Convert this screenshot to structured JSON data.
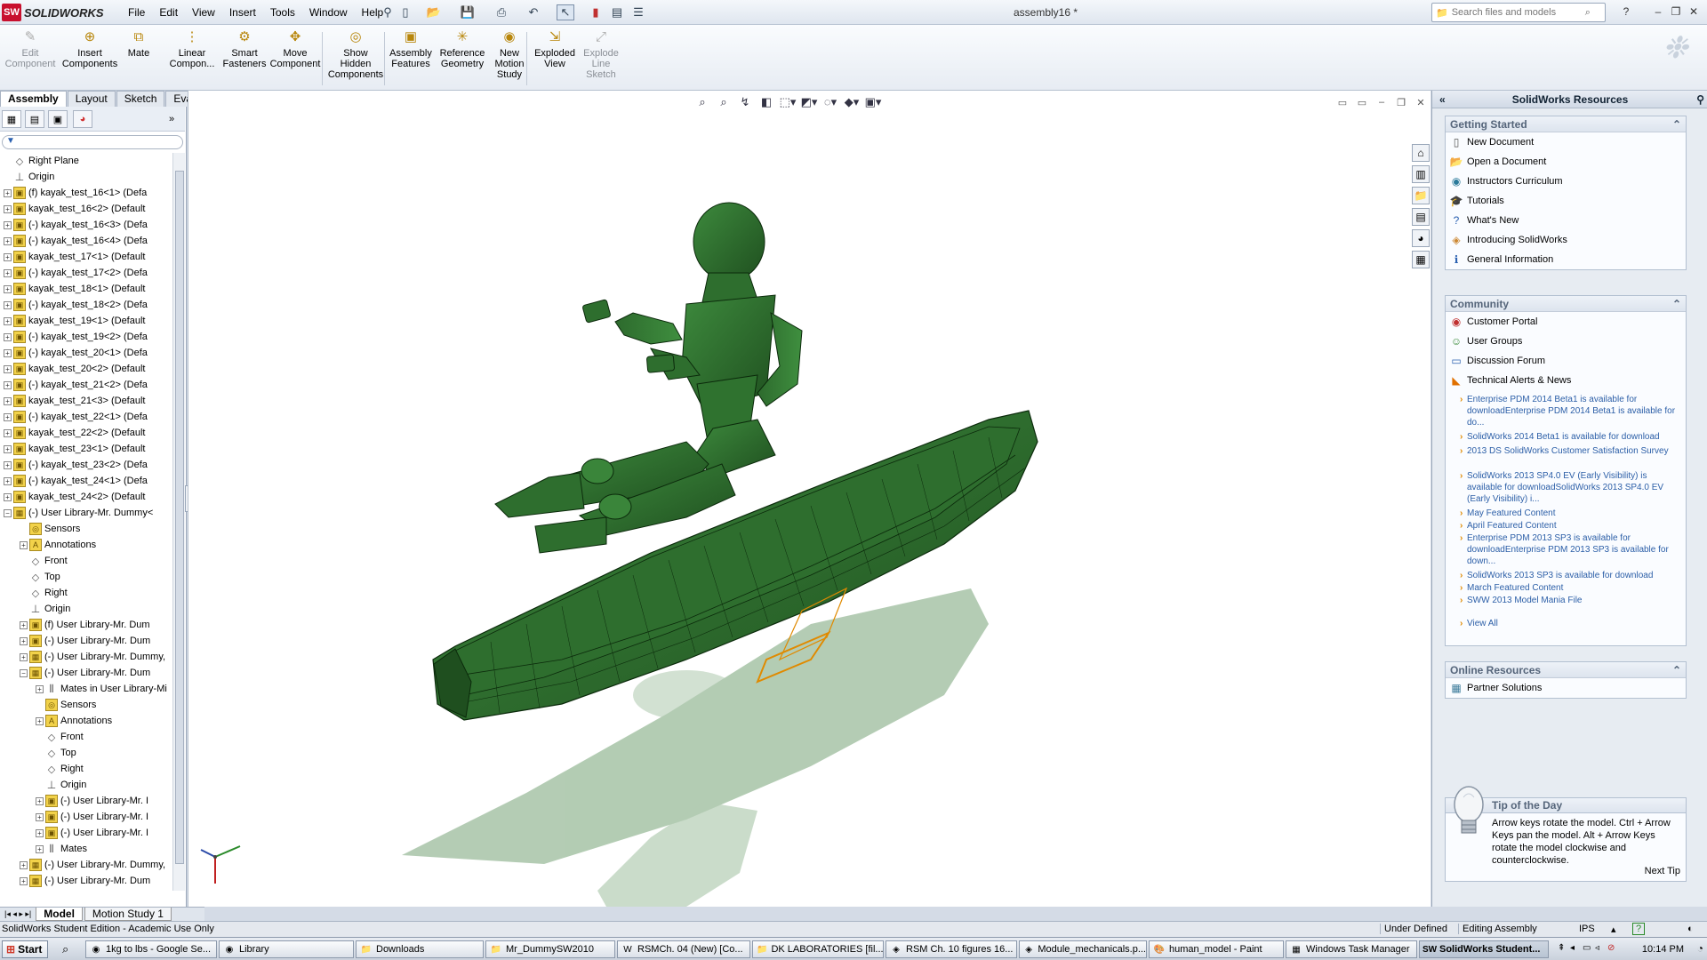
{
  "app": {
    "name": "SOLIDWORKS",
    "doc_title": "assembly16 *"
  },
  "menu": [
    "File",
    "Edit",
    "View",
    "Insert",
    "Tools",
    "Window",
    "Help"
  ],
  "search": {
    "placeholder": "Search files and models"
  },
  "commands": [
    {
      "label": "Edit Component",
      "icon": "edit-component-icon",
      "disabled": true
    },
    {
      "label": "Insert Components",
      "icon": "insert-components-icon"
    },
    {
      "label": "Mate",
      "icon": "mate-icon"
    },
    {
      "label": "Linear Compon...",
      "icon": "linear-pattern-icon"
    },
    {
      "label": "Smart Fasteners",
      "icon": "smart-fasteners-icon"
    },
    {
      "label": "Move Component",
      "icon": "move-component-icon"
    },
    {
      "label": "Show Hidden Components",
      "icon": "show-hidden-icon"
    },
    {
      "label": "Assembly Features",
      "icon": "assembly-features-icon"
    },
    {
      "label": "Reference Geometry",
      "icon": "reference-geometry-icon"
    },
    {
      "label": "New Motion Study",
      "icon": "motion-study-icon"
    },
    {
      "label": "Exploded View",
      "icon": "exploded-view-icon"
    },
    {
      "label": "Explode Line Sketch",
      "icon": "explode-line-icon",
      "disabled": true
    }
  ],
  "cmd_tabs": [
    "Assembly",
    "Layout",
    "Sketch",
    "Evaluate"
  ],
  "tree": [
    {
      "t": "Right Plane",
      "i": "plane",
      "lvl": 0
    },
    {
      "t": "Origin",
      "i": "origin",
      "lvl": 0
    },
    {
      "t": "(f) kayak_test_16<1> (Defa",
      "i": "part",
      "lvl": 0,
      "exp": true
    },
    {
      "t": "kayak_test_16<2> (Default",
      "i": "part",
      "lvl": 0,
      "exp": true
    },
    {
      "t": "(-) kayak_test_16<3> (Defa",
      "i": "part",
      "lvl": 0,
      "exp": true
    },
    {
      "t": "(-) kayak_test_16<4> (Defa",
      "i": "part",
      "lvl": 0,
      "exp": true
    },
    {
      "t": "kayak_test_17<1> (Default",
      "i": "part",
      "lvl": 0,
      "exp": true
    },
    {
      "t": "(-) kayak_test_17<2> (Defa",
      "i": "part",
      "lvl": 0,
      "exp": true
    },
    {
      "t": "kayak_test_18<1> (Default",
      "i": "part",
      "lvl": 0,
      "exp": true
    },
    {
      "t": "(-) kayak_test_18<2> (Defa",
      "i": "part",
      "lvl": 0,
      "exp": true
    },
    {
      "t": "kayak_test_19<1> (Default",
      "i": "part",
      "lvl": 0,
      "exp": true
    },
    {
      "t": "(-) kayak_test_19<2> (Defa",
      "i": "part",
      "lvl": 0,
      "exp": true
    },
    {
      "t": "(-) kayak_test_20<1> (Defa",
      "i": "part",
      "lvl": 0,
      "exp": true
    },
    {
      "t": "kayak_test_20<2> (Default",
      "i": "part",
      "lvl": 0,
      "exp": true
    },
    {
      "t": "(-) kayak_test_21<2> (Defa",
      "i": "part",
      "lvl": 0,
      "exp": true
    },
    {
      "t": "kayak_test_21<3> (Default",
      "i": "part",
      "lvl": 0,
      "exp": true
    },
    {
      "t": "(-) kayak_test_22<1> (Defa",
      "i": "part",
      "lvl": 0,
      "exp": true
    },
    {
      "t": "kayak_test_22<2> (Default",
      "i": "part",
      "lvl": 0,
      "exp": true
    },
    {
      "t": "kayak_test_23<1> (Default",
      "i": "part",
      "lvl": 0,
      "exp": true
    },
    {
      "t": "(-) kayak_test_23<2> (Defa",
      "i": "part",
      "lvl": 0,
      "exp": true
    },
    {
      "t": "(-) kayak_test_24<1> (Defa",
      "i": "part",
      "lvl": 0,
      "exp": true
    },
    {
      "t": "kayak_test_24<2> (Default",
      "i": "part",
      "lvl": 0,
      "exp": true
    },
    {
      "t": "(-) User Library-Mr. Dummy<",
      "i": "asm",
      "lvl": 0,
      "exp": true,
      "open": true
    },
    {
      "t": "Sensors",
      "i": "sensor",
      "lvl": 1
    },
    {
      "t": "Annotations",
      "i": "annot",
      "lvl": 1,
      "exp": true
    },
    {
      "t": "Front",
      "i": "plane",
      "lvl": 1
    },
    {
      "t": "Top",
      "i": "plane",
      "lvl": 1
    },
    {
      "t": "Right",
      "i": "plane",
      "lvl": 1
    },
    {
      "t": "Origin",
      "i": "origin",
      "lvl": 1
    },
    {
      "t": "(f) User Library-Mr. Dum",
      "i": "part",
      "lvl": 1,
      "exp": true
    },
    {
      "t": "(-) User Library-Mr. Dum",
      "i": "part",
      "lvl": 1,
      "exp": true
    },
    {
      "t": "(-) User Library-Mr. Dummy,",
      "i": "asm",
      "lvl": 1,
      "exp": true
    },
    {
      "t": "(-) User Library-Mr. Dum",
      "i": "asm",
      "lvl": 1,
      "exp": true,
      "open": true
    },
    {
      "t": "Mates in User Library-Mi",
      "i": "mates",
      "lvl": 2,
      "exp": true
    },
    {
      "t": "Sensors",
      "i": "sensor",
      "lvl": 2
    },
    {
      "t": "Annotations",
      "i": "annot",
      "lvl": 2,
      "exp": true
    },
    {
      "t": "Front",
      "i": "plane",
      "lvl": 2
    },
    {
      "t": "Top",
      "i": "plane",
      "lvl": 2
    },
    {
      "t": "Right",
      "i": "plane",
      "lvl": 2
    },
    {
      "t": "Origin",
      "i": "origin",
      "lvl": 2
    },
    {
      "t": "(-) User Library-Mr. I",
      "i": "part",
      "lvl": 2,
      "exp": true
    },
    {
      "t": "(-) User Library-Mr. I",
      "i": "part",
      "lvl": 2,
      "exp": true
    },
    {
      "t": "(-) User Library-Mr. I",
      "i": "part",
      "lvl": 2,
      "exp": true
    },
    {
      "t": "Mates",
      "i": "mates",
      "lvl": 2,
      "exp": true
    },
    {
      "t": "(-) User Library-Mr. Dummy,",
      "i": "asm",
      "lvl": 1,
      "exp": true
    },
    {
      "t": "(-) User Library-Mr. Dum",
      "i": "asm",
      "lvl": 1,
      "exp": true
    }
  ],
  "bottom_tabs": [
    "Model",
    "Motion Study 1"
  ],
  "task_pane": {
    "title": "SolidWorks Resources",
    "getting_started": {
      "header": "Getting Started",
      "items": [
        "New Document",
        "Open a Document",
        "Instructors Curriculum",
        "Tutorials",
        "What's New",
        "Introducing SolidWorks",
        "General Information"
      ]
    },
    "community": {
      "header": "Community",
      "items": [
        "Customer Portal",
        "User Groups",
        "Discussion Forum",
        "Technical Alerts & News"
      ],
      "news": [
        "Enterprise PDM 2014 Beta1 is available for downloadEnterprise PDM 2014 Beta1 is available for do...",
        "SolidWorks 2014 Beta1 is available for download",
        "2013 DS SolidWorks Customer Satisfaction Survey",
        "SolidWorks 2013 SP4.0 EV (Early Visibility) is available for downloadSolidWorks 2013 SP4.0 EV (Early Visibility) i...",
        "May Featured Content",
        "April Featured Content",
        "Enterprise PDM 2013 SP3 is available for downloadEnterprise PDM 2013 SP3 is available for down...",
        "SolidWorks 2013 SP3 is available for download",
        "March Featured Content",
        "SWW 2013 Model Mania File",
        "View All"
      ]
    },
    "online": {
      "header": "Online Resources",
      "items": [
        "Partner Solutions"
      ]
    },
    "tip": {
      "header": "Tip of the Day",
      "body": "Arrow keys rotate the model. Ctrl + Arrow Keys pan the model. Alt + Arrow Keys rotate the model clockwise and counterclockwise.",
      "next": "Next Tip"
    }
  },
  "status": {
    "left": "SolidWorks Student Edition - Academic Use Only",
    "state1": "Under Defined",
    "state2": "Editing Assembly",
    "units": "IPS",
    "help": "?"
  },
  "taskbar": {
    "start": "Start",
    "items": [
      "1kg to lbs - Google Se...",
      "Library",
      "Downloads",
      "Mr_DummySW2010",
      "RSMCh. 04 (New) [Co...",
      "DK LABORATORIES [fil...",
      "RSM Ch. 10 figures 16...",
      "Module_mechanicals.p...",
      "human_model - Paint",
      "Windows Task Manager",
      "SolidWorks Student..."
    ],
    "clock": "10:14 PM"
  },
  "colors": {
    "model_green": "#2f6b2f",
    "accent_red": "#c8102e",
    "link_blue": "#2b5ea7"
  }
}
